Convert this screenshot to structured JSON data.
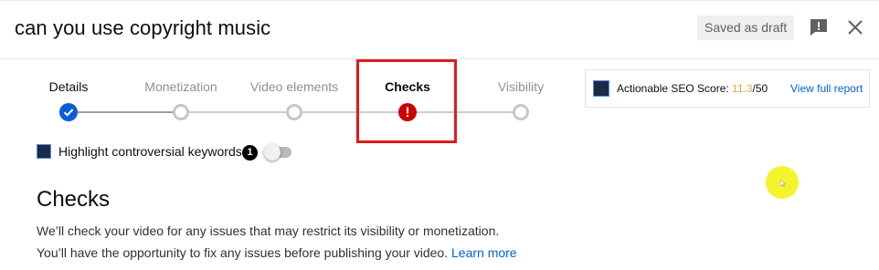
{
  "header": {
    "title": "can you use copyright music",
    "draft_label": "Saved as draft"
  },
  "stepper": {
    "steps": [
      {
        "label": "Details",
        "state": "done"
      },
      {
        "label": "Monetization",
        "state": "pending"
      },
      {
        "label": "Video elements",
        "state": "pending"
      },
      {
        "label": "Checks",
        "state": "error"
      },
      {
        "label": "Visibility",
        "state": "pending"
      }
    ]
  },
  "seo": {
    "label": "Actionable SEO Score: ",
    "score": "11.3",
    "max": "/50",
    "link": "View full report"
  },
  "keywords": {
    "label": "Highlight controversial keywords",
    "count": "1",
    "toggle_on": false
  },
  "checks": {
    "title": "Checks",
    "body": "We’ll check your video for any issues that may restrict its visibility or monetization. You’ll have the opportunity to fix any issues before publishing your video. ",
    "learn_more": "Learn more"
  },
  "icons": {
    "feedback": "feedback-icon",
    "close": "close-icon",
    "step_done": "check-icon",
    "step_error": "exclamation-icon"
  },
  "colors": {
    "accent": "#065fd4",
    "error": "#cc0000",
    "score": "#e8a33c",
    "annotation_box": "#e21a1a",
    "cursor_highlight": "#f5f32c"
  }
}
